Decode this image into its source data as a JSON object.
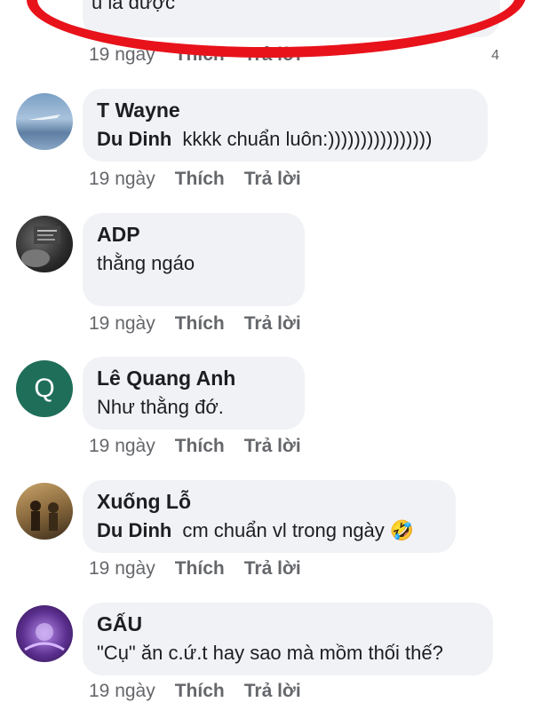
{
  "top_comment": {
    "text_tail": "u là được",
    "time": "19 ngày",
    "like": "Thích",
    "reply": "Trả lời",
    "reaction_count": "4"
  },
  "comments": [
    {
      "author": "T Wayne",
      "mention": "Du Dinh",
      "text": "kkkk chuẩn luôn:))))))))))))))))",
      "time": "19 ngày",
      "like": "Thích",
      "reply": "Trả lời"
    },
    {
      "author": "ADP",
      "mention": "",
      "text": "thằng ngáo",
      "time": "19 ngày",
      "like": "Thích",
      "reply": "Trả lời"
    },
    {
      "author": "Lê Quang Anh",
      "avatar_letter": "Q",
      "mention": "",
      "text": "Như thằng đớ.",
      "time": "19 ngày",
      "like": "Thích",
      "reply": "Trả lời"
    },
    {
      "author": "Xuống Lỗ",
      "mention": "Du Dinh",
      "text": "cm chuẩn vl trong ngày",
      "emoji": "🤣",
      "time": "19 ngày",
      "like": "Thích",
      "reply": "Trả lời"
    },
    {
      "author": "GẤU",
      "mention": "",
      "text": "\"Cụ\" ăn c.ứ.t hay sao mà mồm thối thế?",
      "time": "19 ngày",
      "like": "Thích",
      "reply": "Trả lời"
    }
  ],
  "colors": {
    "bubble": "#f0f2f5",
    "meta": "#65676b",
    "highlight_oval": "#e8121b",
    "avatar_q": "#1f6e5a"
  }
}
